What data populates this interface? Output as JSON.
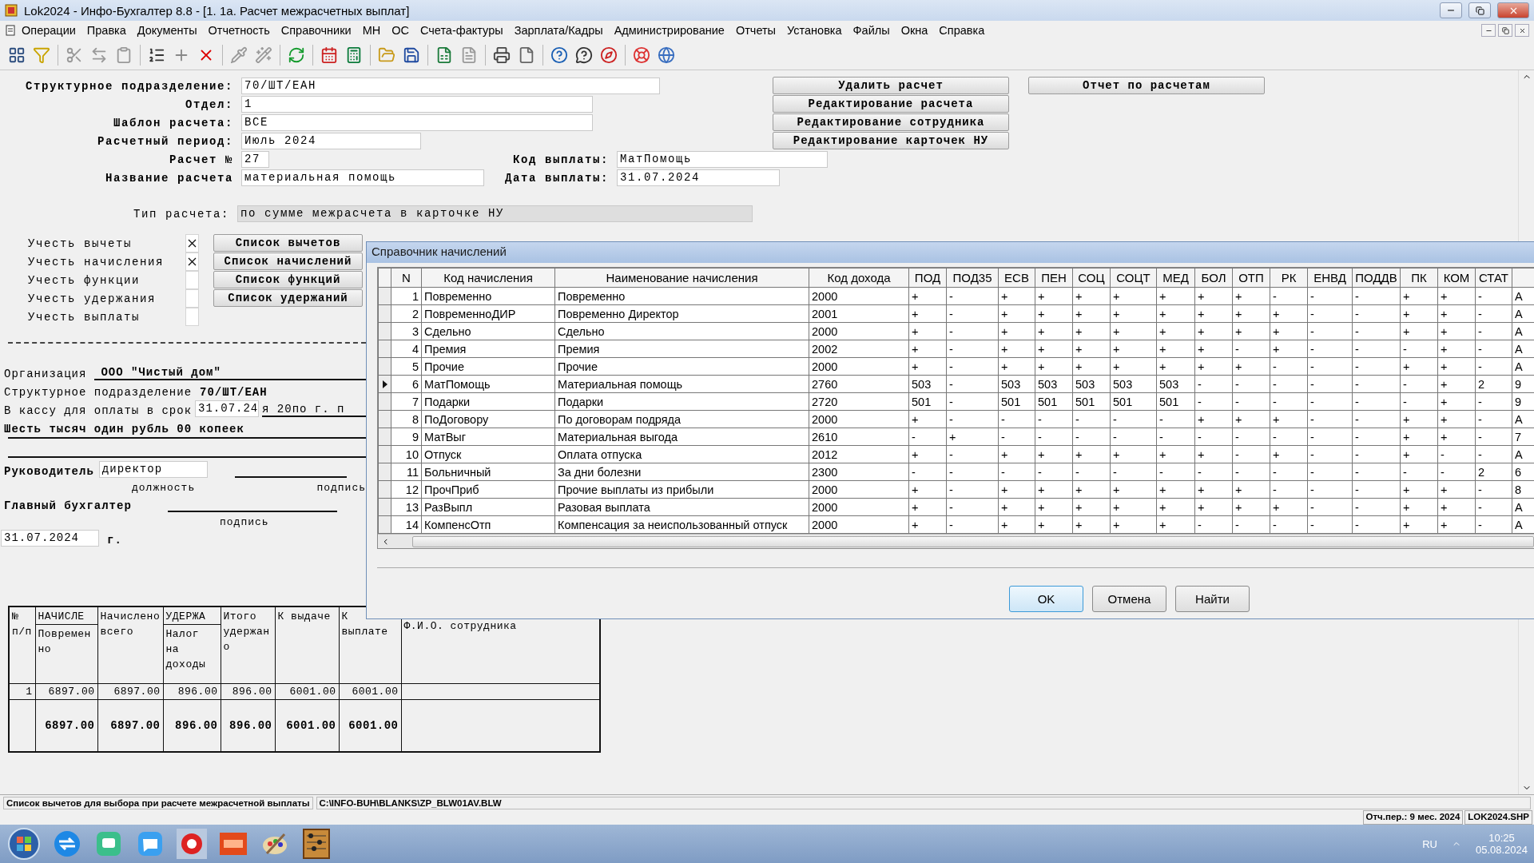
{
  "window": {
    "title": "Lok2024 - Инфо-Бухгалтер 8.8 - [1. 1а. Расчет межрасчетных выплат]",
    "menu": [
      "Операции",
      "Правка",
      "Документы",
      "Отчетность",
      "Справочники",
      "МН",
      "ОС",
      "Счета-фактуры",
      "Зарплата/Кадры",
      "Администрирование",
      "Отчеты",
      "Установка",
      "Файлы",
      "Окна",
      "Справка"
    ]
  },
  "form": {
    "subdivision": {
      "label": "Структурное подразделение:",
      "value": "70/ШТ/ЕАН"
    },
    "department": {
      "label": "Отдел:",
      "value": "1"
    },
    "template": {
      "label": "Шаблон расчета:",
      "value": "ВСЕ"
    },
    "period": {
      "label": "Расчетный период:",
      "value": "Июль 2024"
    },
    "number": {
      "label": "Расчет №",
      "value": "27"
    },
    "payment_code": {
      "label": "Код выплаты:",
      "value": "МатПомощь"
    },
    "name": {
      "label": "Название расчета",
      "value": "материальная помощь"
    },
    "payment_date": {
      "label": "Дата выплаты:",
      "value": "31.07.2024"
    },
    "type": {
      "label": "Тип расчета:",
      "value": "по сумме межрасчета в карточке НУ"
    }
  },
  "actions": [
    "Удалить расчет",
    "Редактирование расчета",
    "Редактирование сотрудника",
    "Редактирование карточек НУ"
  ],
  "report_button": "Отчет по расчетам",
  "options": [
    {
      "label": "Учесть вычеты",
      "checked": true
    },
    {
      "label": "Учесть начисления",
      "checked": true
    },
    {
      "label": "Учесть функции",
      "checked": false
    },
    {
      "label": "Учесть удержания",
      "checked": false
    },
    {
      "label": "Учесть выплаты",
      "checked": false
    }
  ],
  "option_buttons": [
    "Список вычетов",
    "Список начислений",
    "Список функций",
    "Список удержаний"
  ],
  "voucher": {
    "organization_label": "Организация",
    "organization": "ООО \"Чистый дом\"",
    "subdivision_label": "Структурное подразделение",
    "subdivision": "70/ШТ/ЕАН",
    "cash_label": "В кассу для оплаты в срок",
    "cash_date": "31.07.24",
    "cash_tail": "я 20по г. п",
    "amount_words": "Шесть тысяч один рубль 00 копеек",
    "head_label": "Руководитель",
    "head_position": "директор",
    "position_caption": "должность",
    "signature_caption": "подпись",
    "accountant_label": "Главный бухгалтер",
    "accountant_signature_caption": "подпись",
    "date": "31.07.2024",
    "year_suffix": "г."
  },
  "payroll_table": {
    "headers": [
      {
        "text": "№ п/п"
      },
      {
        "group": "НАЧИСЛЕ",
        "text": "Повременно"
      },
      {
        "text": "Начислено всего"
      },
      {
        "group": "УДЕРЖА",
        "text": "Налог на доходы"
      },
      {
        "text": "Итого удержано"
      },
      {
        "text": "К выдаче"
      },
      {
        "text": "К выплате"
      },
      {
        "text": "Ф.И.О. сотрудника"
      }
    ],
    "rows": [
      [
        "1",
        "6897.00",
        "6897.00",
        "896.00",
        "896.00",
        "6001.00",
        "6001.00"
      ]
    ],
    "totals": [
      "6897.00",
      "6897.00",
      "896.00",
      "896.00",
      "6001.00",
      "6001.00"
    ]
  },
  "dialog": {
    "title": "Справочник начислений",
    "columns": [
      "N",
      "Код начисления",
      "Наименование начисления",
      "Код дохода",
      "ПОД",
      "ПОД35",
      "ЕСВ",
      "ПЕН",
      "СОЦ",
      "СОЦТ",
      "МЕД",
      "БОЛ",
      "ОТП",
      "РК",
      "ЕНВД",
      "ПОДДВ",
      "ПК",
      "КОМ",
      "СТАТ"
    ],
    "rows": [
      {
        "selected": false,
        "cells": [
          "1",
          "Повременно",
          "Повременно",
          "2000",
          "+",
          "-",
          "+",
          "+",
          "+",
          "+",
          "+",
          "+",
          "+",
          "-",
          "-",
          "-",
          "+",
          "+",
          "-",
          "A"
        ]
      },
      {
        "selected": false,
        "cells": [
          "2",
          "ПовременноДИР",
          "Повременно Директор",
          "2001",
          "+",
          "-",
          "+",
          "+",
          "+",
          "+",
          "+",
          "+",
          "+",
          "+",
          "-",
          "-",
          "+",
          "+",
          "-",
          "A"
        ]
      },
      {
        "selected": false,
        "cells": [
          "3",
          "Сдельно",
          "Сдельно",
          "2000",
          "+",
          "-",
          "+",
          "+",
          "+",
          "+",
          "+",
          "+",
          "+",
          "+",
          "-",
          "-",
          "+",
          "+",
          "-",
          "A"
        ]
      },
      {
        "selected": false,
        "cells": [
          "4",
          "Премия",
          "Премия",
          "2002",
          "+",
          "-",
          "+",
          "+",
          "+",
          "+",
          "+",
          "+",
          "-",
          "+",
          "-",
          "-",
          "-",
          "+",
          "-",
          "A"
        ]
      },
      {
        "selected": false,
        "cells": [
          "5",
          "Прочие",
          "Прочие",
          "2000",
          "+",
          "-",
          "+",
          "+",
          "+",
          "+",
          "+",
          "+",
          "+",
          "-",
          "-",
          "-",
          "+",
          "+",
          "-",
          "A"
        ]
      },
      {
        "selected": true,
        "cells": [
          "6",
          "МатПомощь",
          "Материальная помощь",
          "2760",
          "503",
          "-",
          "503",
          "503",
          "503",
          "503",
          "503",
          "-",
          "-",
          "-",
          "-",
          "-",
          "-",
          "+",
          "2",
          "9"
        ]
      },
      {
        "selected": false,
        "cells": [
          "7",
          "Подарки",
          "Подарки",
          "2720",
          "501",
          "-",
          "501",
          "501",
          "501",
          "501",
          "501",
          "-",
          "-",
          "-",
          "-",
          "-",
          "-",
          "+",
          "-",
          "9"
        ]
      },
      {
        "selected": false,
        "cells": [
          "8",
          "ПоДоговору",
          "По договорам подряда",
          "2000",
          "+",
          "-",
          "-",
          "-",
          "-",
          "-",
          "-",
          "+",
          "+",
          "+",
          "-",
          "-",
          "+",
          "+",
          "-",
          "A"
        ]
      },
      {
        "selected": false,
        "cells": [
          "9",
          "МатВыг",
          "Материальная выгода",
          "2610",
          "-",
          "+",
          "-",
          "-",
          "-",
          "-",
          "-",
          "-",
          "-",
          "-",
          "-",
          "-",
          "+",
          "+",
          "-",
          "7"
        ]
      },
      {
        "selected": false,
        "cells": [
          "10",
          "Отпуск",
          "Оплата отпуска",
          "2012",
          "+",
          "-",
          "+",
          "+",
          "+",
          "+",
          "+",
          "+",
          "-",
          "+",
          "-",
          "-",
          "+",
          "-",
          "-",
          "A"
        ]
      },
      {
        "selected": false,
        "cells": [
          "11",
          "Больничный",
          "За дни болезни",
          "2300",
          "-",
          "-",
          "-",
          "-",
          "-",
          "-",
          "-",
          "-",
          "-",
          "-",
          "-",
          "-",
          "-",
          "-",
          "2",
          "6"
        ]
      },
      {
        "selected": false,
        "cells": [
          "12",
          "ПрочПриб",
          "Прочие выплаты из прибыли",
          "2000",
          "+",
          "-",
          "+",
          "+",
          "+",
          "+",
          "+",
          "+",
          "+",
          "-",
          "-",
          "-",
          "+",
          "+",
          "-",
          "8"
        ]
      },
      {
        "selected": false,
        "cells": [
          "13",
          "РазВыпл",
          "Разовая выплата",
          "2000",
          "+",
          "-",
          "+",
          "+",
          "+",
          "+",
          "+",
          "+",
          "+",
          "+",
          "-",
          "-",
          "+",
          "+",
          "-",
          "A"
        ]
      },
      {
        "selected": false,
        "cells": [
          "14",
          "КомпенсОтп",
          "Компенсация за неиспользованный отпуск",
          "2000",
          "+",
          "-",
          "+",
          "+",
          "+",
          "+",
          "+",
          "-",
          "-",
          "-",
          "-",
          "-",
          "+",
          "+",
          "-",
          "A"
        ]
      }
    ],
    "buttons": [
      {
        "label": "OK",
        "default": true
      },
      {
        "label": "Отмена",
        "default": false
      },
      {
        "label": "Найти",
        "default": false
      }
    ]
  },
  "status_bar": {
    "hint": "Список вычетов для выбора при расчете межрасчетной выплаты",
    "path": "C:\\INFO-BUH\\BLANKS\\ZP_BLW01AV.BLW"
  },
  "info_bar": [
    "Отч.пер.: 9 мес. 2024",
    "LOK2024.SHP"
  ],
  "taskbar": {
    "language": "RU",
    "time": "10:25",
    "date": "05.08.2024"
  }
}
